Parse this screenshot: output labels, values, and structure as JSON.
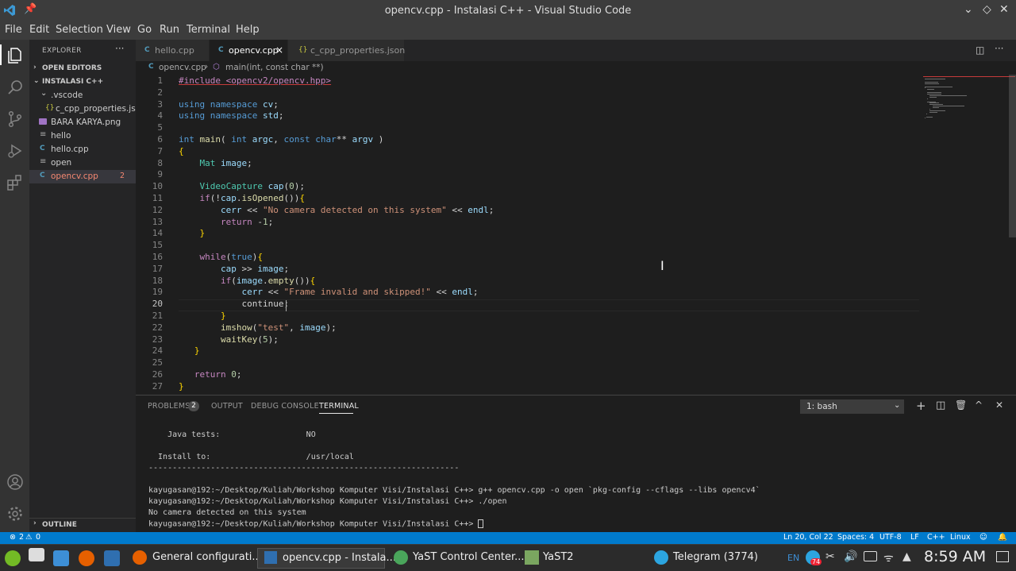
{
  "window": {
    "title": "opencv.cpp - Instalasi C++ - Visual Studio Code"
  },
  "menu": [
    "File",
    "Edit",
    "Selection",
    "View",
    "Go",
    "Run",
    "Terminal",
    "Help"
  ],
  "sidebar": {
    "header": "EXPLORER",
    "open_editors": "OPEN EDITORS",
    "folder": "INSTALASI C++",
    "items": [
      {
        "label": ".vscode"
      },
      {
        "label": "c_cpp_properties.js..."
      },
      {
        "label": "BARA KARYA.png"
      },
      {
        "label": "hello"
      },
      {
        "label": "hello.cpp"
      },
      {
        "label": "open"
      },
      {
        "label": "opencv.cpp",
        "badge": "2"
      }
    ],
    "outline": "OUTLINE"
  },
  "tabs": [
    {
      "label": "hello.cpp"
    },
    {
      "label": "opencv.cpp",
      "close": "×"
    },
    {
      "label": "c_cpp_properties.json"
    }
  ],
  "breadcrumb": {
    "file": "opencv.cpp",
    "symbol": "main(int, const char **)"
  },
  "code": [
    "#include <opencv2/opencv.hpp>",
    "",
    "using namespace cv;",
    "using namespace std;",
    "",
    "int main( int argc, const char** argv )",
    "{",
    "    Mat image;",
    "",
    "    VideoCapture cap(0);",
    "    if(!cap.isOpened()){",
    "        cerr << \"No camera detected on this system\" << endl;",
    "        return -1;",
    "    }",
    "",
    "    while(true){",
    "        cap >> image;",
    "        if(image.empty()){",
    "            cerr << \"Frame invalid and skipped!\" << endl;",
    "            continue;",
    "        }",
    "        imshow(\"test\", image);",
    "        waitKey(5);",
    "   }",
    "",
    "   return 0;",
    "}"
  ],
  "line_numbers": [
    "1",
    "2",
    "3",
    "4",
    "5",
    "6",
    "7",
    "8",
    "9",
    "10",
    "11",
    "12",
    "13",
    "14",
    "15",
    "16",
    "17",
    "18",
    "19",
    "20",
    "21",
    "22",
    "23",
    "24",
    "25",
    "26",
    "27"
  ],
  "panel": {
    "tabs": [
      {
        "label": "PROBLEMS",
        "badge": "2"
      },
      {
        "label": "OUTPUT"
      },
      {
        "label": "DEBUG CONSOLE"
      },
      {
        "label": "TERMINAL"
      }
    ],
    "terminal_select": "1: bash",
    "terminal_lines": [
      "    Java tests:                  NO",
      "",
      "  Install to:                    /usr/local",
      "-----------------------------------------------------------------",
      "",
      "kayugasan@192:~/Desktop/Kuliah/Workshop Komputer Visi/Instalasi C++> g++ opencv.cpp -o open `pkg-config --cflags --libs opencv4`",
      "kayugasan@192:~/Desktop/Kuliah/Workshop Komputer Visi/Instalasi C++> ./open",
      "No camera detected on this system",
      "kayugasan@192:~/Desktop/Kuliah/Workshop Komputer Visi/Instalasi C++> "
    ]
  },
  "status": {
    "errors": "2",
    "warnings": "0",
    "position": "Ln 20, Col 22",
    "spaces": "Spaces: 4",
    "encoding": "UTF-8",
    "eol": "LF",
    "language": "C++",
    "platform": "Linux"
  },
  "taskbar": {
    "items": [
      {
        "label": "General configurati..."
      },
      {
        "label": "opencv.cpp - Instala..."
      },
      {
        "label": "YaST Control Center..."
      },
      {
        "label": "YaST2"
      },
      {
        "label": "Telegram (3774)"
      }
    ],
    "lang": "EN",
    "notif_badge": "74",
    "clock": "8:59 AM"
  },
  "colors": {
    "accent": "#007acc",
    "titlebar": "#3c3c3c",
    "editor_bg": "#1e1e1e"
  }
}
